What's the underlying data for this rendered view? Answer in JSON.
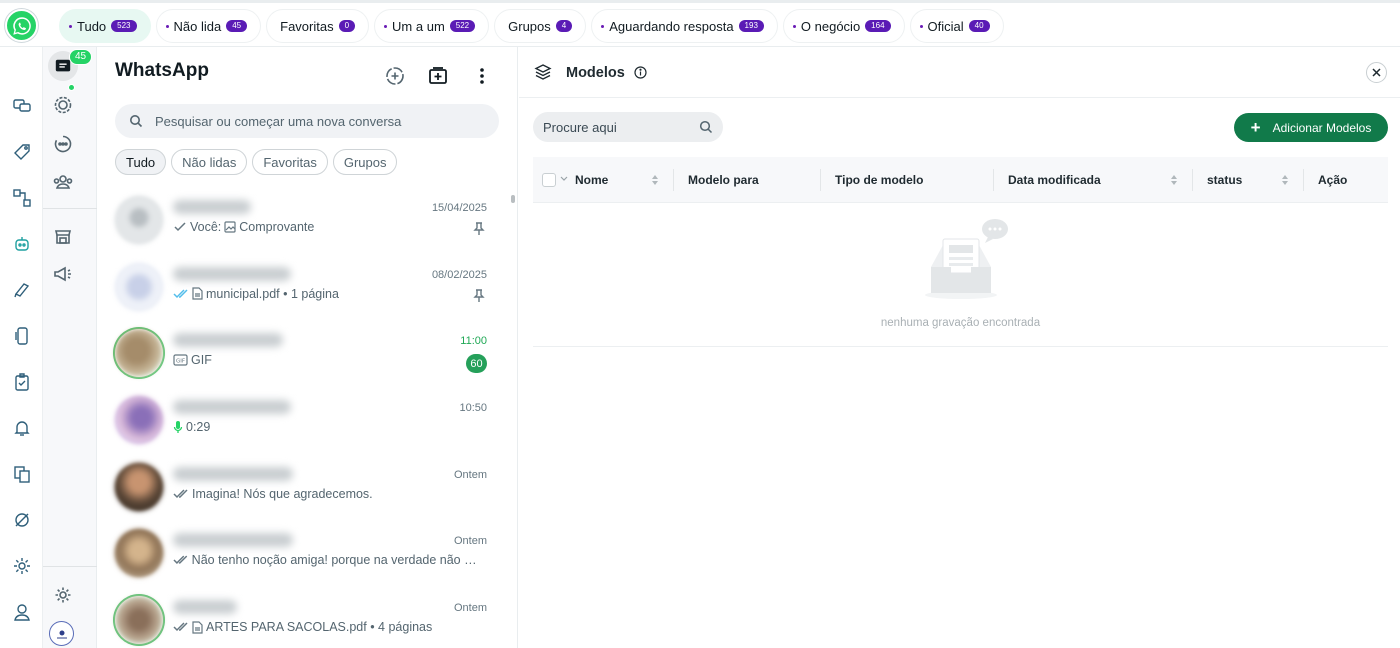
{
  "filters": [
    {
      "label": "Tudo",
      "count": "523",
      "active": true
    },
    {
      "label": "Não lida",
      "count": "45"
    },
    {
      "label": "Favoritas",
      "count": "0"
    },
    {
      "label": "Um a um",
      "count": "522"
    },
    {
      "label": "Grupos",
      "count": "4"
    },
    {
      "label": "Aguardando resposta",
      "count": "193"
    },
    {
      "label": "O negócio",
      "count": "164"
    },
    {
      "label": "Oficial",
      "count": "40"
    }
  ],
  "nav": {
    "chats_badge": "45"
  },
  "chat_panel": {
    "title": "WhatsApp",
    "search_placeholder": "Pesquisar ou começar uma nova conversa",
    "chips": [
      "Tudo",
      "Não lidas",
      "Favoritas",
      "Grupos"
    ]
  },
  "chats": [
    {
      "date": "15/04/2025",
      "preview": "Você: ",
      "preview2": "Comprovante",
      "pinned": true
    },
    {
      "date": "08/02/2025",
      "preview": "municipal.pdf • 1 página",
      "pinned": true
    },
    {
      "date": "11:00",
      "preview": "GIF",
      "unread": "60"
    },
    {
      "date": "10:50",
      "preview": "0:29"
    },
    {
      "date": "Ontem",
      "preview": "Imagina! Nós que agradecemos."
    },
    {
      "date": "Ontem",
      "preview": "Não tenho noção amiga! porque na verdade não te..."
    },
    {
      "date": "Ontem",
      "preview": "ARTES PARA SACOLAS.pdf • 4 páginas"
    }
  ],
  "models_panel": {
    "title": "Modelos",
    "search_placeholder": "Procure aqui",
    "add_button": "Adicionar Modelos",
    "columns": [
      "Nome",
      "Modelo para",
      "Tipo de modelo",
      "Data modificada",
      "status",
      "Ação"
    ],
    "empty_text": "nenhuma gravação encontrada"
  },
  "colors": {
    "accent": "#25d366",
    "badge": "#5a1bb5",
    "button": "#117a4a"
  }
}
